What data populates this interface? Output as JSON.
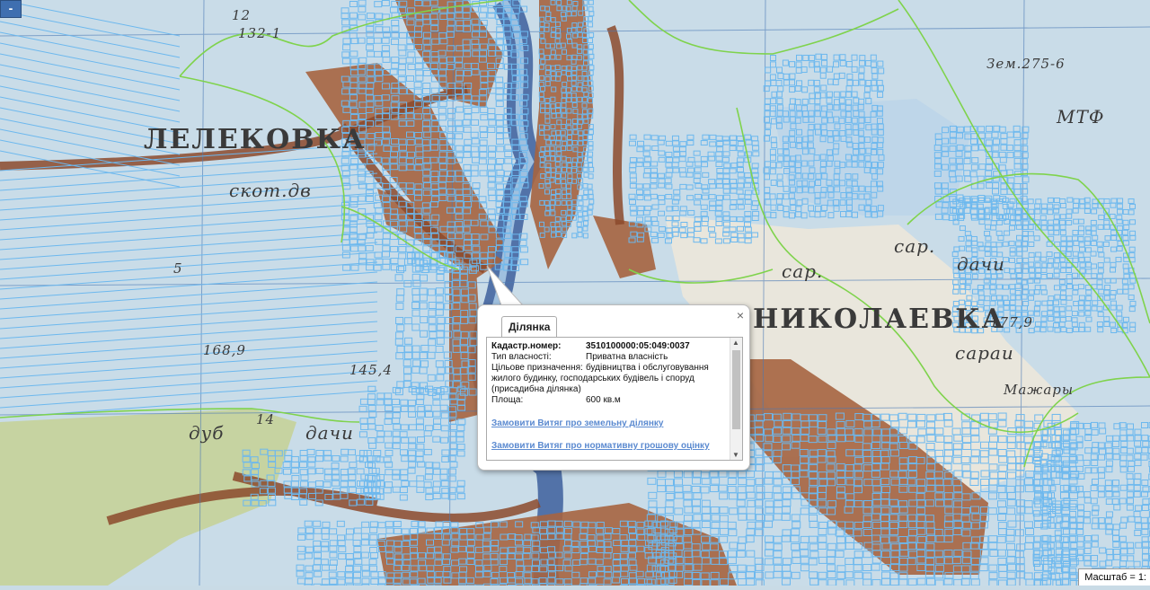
{
  "map": {
    "labels": {
      "village_left": "ЛЕЛЕКОВКА",
      "village_right": "НИКОЛАЕВКА",
      "skot_dv": "скот.дв",
      "dachi_right": "дачи",
      "dachi_left": "дачи",
      "dub": "дуб",
      "sar_a": "сар.",
      "sar_b": "сар.",
      "sarai": "сараи",
      "mtf": "МТФ",
      "mazhary": "Мажары",
      "height_168": "168,9",
      "height_145": "145,4",
      "height_1779": "177,9",
      "zem": "Зем.275-6",
      "n_12": "12",
      "n_132": "132-1",
      "n_5": "5",
      "n_14": "14"
    },
    "zoom_out_label": "-",
    "scale_text": "Масштаб = 1:"
  },
  "popup": {
    "close_label": "×",
    "tab_label": "Ділянка",
    "fields": {
      "cadastral_label": "Кадастр.номер:",
      "cadastral_value": "3510100000:05:049:0037",
      "ownership_label": "Тип власності:",
      "ownership_value": "Приватна власність",
      "purpose_label": "Цільове призначення:",
      "purpose_value_first": "будівництва і обслуговування",
      "purpose_value_rest": "жилого будинку, господарських будівель і споруд (присадибна ділянка)",
      "area_label": "Площа:",
      "area_value": "600 кв.м"
    },
    "links": {
      "extract_land": "Замовити Витяг про земельну ділянку",
      "extract_valuation": "Замовити Витяг про нормативну грошову оцінку"
    },
    "scroll_up": "▲",
    "scroll_down": "▼"
  },
  "colors": {
    "water": "#bcd6e8",
    "settlement": "#a6603a",
    "forest": "#c8d6a8",
    "parcel": "#6fb9ec",
    "boundary": "#7fd34c",
    "river": "#3d5f9c"
  }
}
